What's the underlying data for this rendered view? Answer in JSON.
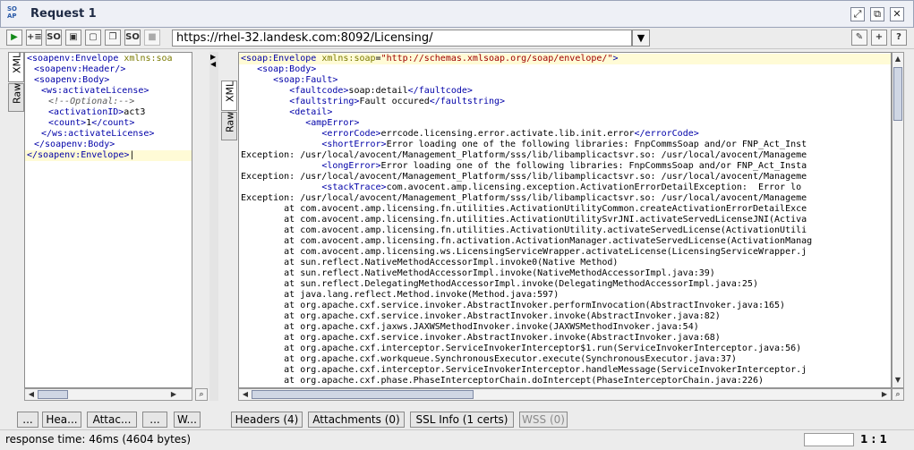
{
  "window": {
    "logo_text": "SO\nAP",
    "title": "Request 1",
    "controls": [
      "⤢",
      "⧉",
      "✕"
    ]
  },
  "toolbar": {
    "buttons": [
      {
        "name": "submit-request-icon",
        "glyph": "▶"
      },
      {
        "name": "add-assertion-icon",
        "glyph": "+≡"
      },
      {
        "name": "create-mock-icon",
        "glyph": "SO"
      },
      {
        "name": "tile-view-icon",
        "glyph": "▣"
      },
      {
        "name": "split-view-icon",
        "glyph": "▢"
      },
      {
        "name": "tabbed-view-icon",
        "glyph": "❐"
      },
      {
        "name": "soap-options-icon",
        "glyph": "SO"
      },
      {
        "name": "cancel-request-icon",
        "glyph": "■"
      }
    ],
    "endpoint_url": "https://rhel-32.landesk.com:8092/Licensing/",
    "right_buttons": [
      {
        "name": "edit-endpoint-icon",
        "glyph": "✎"
      },
      {
        "name": "add-icon",
        "glyph": "+"
      },
      {
        "name": "help-icon",
        "glyph": "?"
      }
    ]
  },
  "left_pane": {
    "tabs": [
      "XML",
      "Raw"
    ],
    "active_tab": "XML",
    "lines": [
      {
        "indent": 0,
        "html": "<span class='tag'>&lt;soapenv:Envelope</span> <span class='attr'>xmlns:soa</span>"
      },
      {
        "indent": 2,
        "html": "<span class='tag'>&lt;soapenv:Header/&gt;</span>"
      },
      {
        "indent": 2,
        "html": "<span class='tag'>&lt;soapenv:Body&gt;</span>"
      },
      {
        "indent": 4,
        "html": "<span class='tag'>&lt;ws:activateLicense&gt;</span>"
      },
      {
        "indent": 6,
        "html": "<span class='cmt'>&lt;!--Optional:--&gt;</span>"
      },
      {
        "indent": 6,
        "html": "<span class='tag'>&lt;activationID&gt;</span>act3"
      },
      {
        "indent": 6,
        "html": "<span class='tag'>&lt;count&gt;</span>1<span class='tag'>&lt;/count&gt;</span>"
      },
      {
        "indent": 4,
        "html": "<span class='tag'>&lt;/ws:activateLicense&gt;</span>"
      },
      {
        "indent": 2,
        "html": "<span class='tag'>&lt;/soapenv:Body&gt;</span>"
      },
      {
        "indent": 0,
        "html": "<span class='tag'>&lt;/soapenv:Envelope&gt;</span>|",
        "highlight": true
      }
    ],
    "bottom_tabs": [
      "...",
      "Hea...",
      "Attac...",
      "...",
      "W..."
    ]
  },
  "right_pane": {
    "tabs": [
      "XML",
      "Raw"
    ],
    "active_tab": "XML",
    "lines": [
      {
        "html": "<span class='tag'>&lt;soap:Envelope</span> <span class='attr'>xmlns:soap</span>=<span class='aval'>\"http://schemas.xmlsoap.org/soap/envelope/\"</span><span class='tag'>&gt;</span>",
        "highlight": true
      },
      {
        "html": "   <span class='tag'>&lt;soap:Body&gt;</span>"
      },
      {
        "html": "      <span class='tag'>&lt;soap:Fault&gt;</span>"
      },
      {
        "html": "         <span class='tag'>&lt;faultcode&gt;</span>soap:detail<span class='tag'>&lt;/faultcode&gt;</span>"
      },
      {
        "html": "         <span class='tag'>&lt;faultstring&gt;</span>Fault occured<span class='tag'>&lt;/faultstring&gt;</span>"
      },
      {
        "html": "         <span class='tag'>&lt;detail&gt;</span>"
      },
      {
        "html": "            <span class='tag'>&lt;ampError&gt;</span>"
      },
      {
        "html": "               <span class='tag'>&lt;errorCode&gt;</span>errcode.licensing.error.activate.lib.init.error<span class='tag'>&lt;/errorCode&gt;</span>"
      },
      {
        "html": "               <span class='tag'>&lt;shortError&gt;</span>Error loading one of the following libraries: FnpCommsSoap and/or FNP_Act_Inst"
      },
      {
        "html": "Exception: /usr/local/avocent/Management_Platform/sss/lib/libamplicactsvr.so: /usr/local/avocent/Manageme"
      },
      {
        "html": "               <span class='tag'>&lt;longError&gt;</span>Error loading one of the following libraries: FnpCommsSoap and/or FNP_Act_Insta"
      },
      {
        "html": "Exception: /usr/local/avocent/Management_Platform/sss/lib/libamplicactsvr.so: /usr/local/avocent/Manageme"
      },
      {
        "html": "               <span class='tag'>&lt;stackTrace&gt;</span>com.avocent.amp.licensing.exception.ActivationErrorDetailException:  Error lo"
      },
      {
        "html": "Exception: /usr/local/avocent/Management_Platform/sss/lib/libamplicactsvr.so: /usr/local/avocent/Manageme"
      },
      {
        "html": "        at com.avocent.amp.licensing.fn.utilities.ActivationUtilityCommon.createActivationErrorDetailExce"
      },
      {
        "html": "        at com.avocent.amp.licensing.fn.utilities.ActivationUtilitySvrJNI.activateServedLicenseJNI(Activa"
      },
      {
        "html": "        at com.avocent.amp.licensing.fn.utilities.ActivationUtility.activateServedLicense(ActivationUtili"
      },
      {
        "html": "        at com.avocent.amp.licensing.fn.activation.ActivationManager.activateServedLicense(ActivationManag"
      },
      {
        "html": "        at com.avocent.amp.licensing.ws.LicensingServiceWrapper.activateLicense(LicensingServiceWrapper.j"
      },
      {
        "html": "        at sun.reflect.NativeMethodAccessorImpl.invoke0(Native Method)"
      },
      {
        "html": "        at sun.reflect.NativeMethodAccessorImpl.invoke(NativeMethodAccessorImpl.java:39)"
      },
      {
        "html": "        at sun.reflect.DelegatingMethodAccessorImpl.invoke(DelegatingMethodAccessorImpl.java:25)"
      },
      {
        "html": "        at java.lang.reflect.Method.invoke(Method.java:597)"
      },
      {
        "html": "        at org.apache.cxf.service.invoker.AbstractInvoker.performInvocation(AbstractInvoker.java:165)"
      },
      {
        "html": "        at org.apache.cxf.service.invoker.AbstractInvoker.invoke(AbstractInvoker.java:82)"
      },
      {
        "html": "        at org.apache.cxf.jaxws.JAXWSMethodInvoker.invoke(JAXWSMethodInvoker.java:54)"
      },
      {
        "html": "        at org.apache.cxf.service.invoker.AbstractInvoker.invoke(AbstractInvoker.java:68)"
      },
      {
        "html": "        at org.apache.cxf.interceptor.ServiceInvokerInterceptor$1.run(ServiceInvokerInterceptor.java:56)"
      },
      {
        "html": "        at org.apache.cxf.workqueue.SynchronousExecutor.execute(SynchronousExecutor.java:37)"
      },
      {
        "html": "        at org.apache.cxf.interceptor.ServiceInvokerInterceptor.handleMessage(ServiceInvokerInterceptor.j"
      },
      {
        "html": "        at org.apache.cxf.phase.PhaseInterceptorChain.doIntercept(PhaseInterceptorChain.java:226)"
      }
    ],
    "bottom_tabs": [
      {
        "label": "Headers (4)",
        "disabled": false
      },
      {
        "label": "Attachments (0)",
        "disabled": false
      },
      {
        "label": "SSL Info (1 certs)",
        "disabled": false
      },
      {
        "label": "WSS (0)",
        "disabled": true
      }
    ]
  },
  "status": {
    "response_time": "response time: 46ms (4604 bytes)",
    "cursor_pos": "1 : 1"
  }
}
